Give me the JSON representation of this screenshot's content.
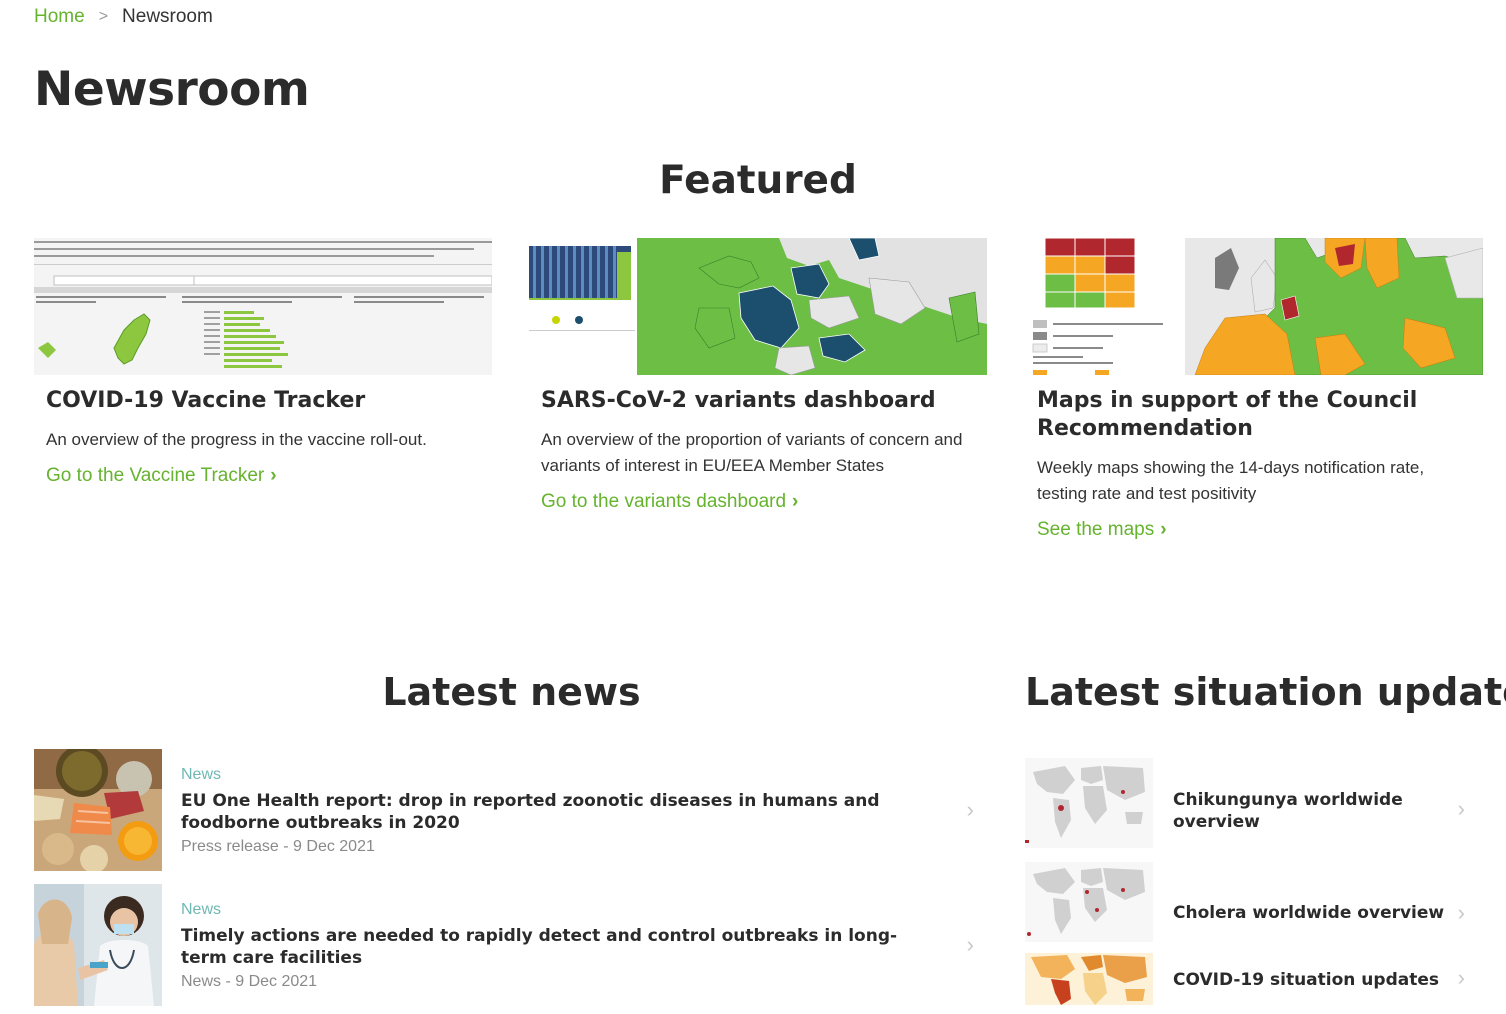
{
  "breadcrumb": {
    "home": "Home",
    "separator": ">",
    "current": "Newsroom"
  },
  "page_title": "Newsroom",
  "featured": {
    "title": "Featured",
    "cards": [
      {
        "title": "COVID-19 Vaccine Tracker",
        "description": "An overview of the progress in the vaccine roll-out.",
        "link": "Go to the Vaccine Tracker",
        "link_icon": "chevron-right-icon"
      },
      {
        "title": "SARS-CoV-2 variants dashboard",
        "description": "An overview of the proportion of variants of concern and variants of interest in EU/EEA Member States",
        "link": "Go to the variants dashboard",
        "link_icon": "chevron-right-icon"
      },
      {
        "title": "Maps in support of the Council Recommendation",
        "description": "Weekly maps showing the 14-days notification rate, testing rate and test positivity",
        "link": "See the maps",
        "link_icon": "chevron-right-icon"
      }
    ]
  },
  "latest_news": {
    "title": "Latest news",
    "items": [
      {
        "category": "News",
        "title": "EU One Health report: drop in reported zoonotic diseases in humans and foodborne outbreaks in 2020",
        "meta": "Press release - 9 Dec 2021"
      },
      {
        "category": "News",
        "title": "Timely actions are needed to rapidly detect and control outbreaks in long-term care facilities",
        "meta": "News - 9 Dec 2021"
      }
    ]
  },
  "situation_updates": {
    "title": "Latest situation updates",
    "items": [
      {
        "title": "Chikungunya worldwide overview"
      },
      {
        "title": "Cholera worldwide overview"
      },
      {
        "title": "COVID-19 situation updates"
      }
    ]
  },
  "colors": {
    "accent_green": "#65b32e",
    "heading": "#2b2b2b",
    "category_teal": "#6fb8b3",
    "meta_gray": "#8a8a8a"
  }
}
